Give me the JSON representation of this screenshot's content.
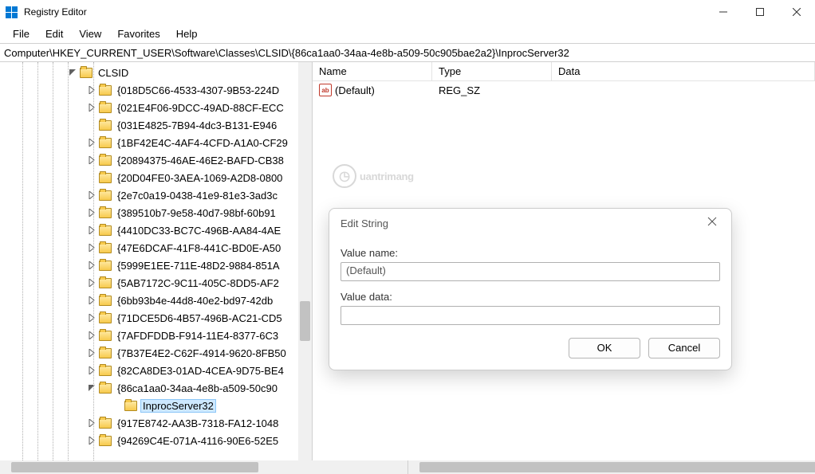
{
  "titlebar": {
    "title": "Registry Editor"
  },
  "menu": {
    "file": "File",
    "edit": "Edit",
    "view": "View",
    "favorites": "Favorites",
    "help": "Help"
  },
  "address": "Computer\\HKEY_CURRENT_USER\\Software\\Classes\\CLSID\\{86ca1aa0-34aa-4e8b-a509-50c905bae2a2}\\InprocServer32",
  "tree": {
    "root": "CLSID",
    "items": [
      "{018D5C66-4533-4307-9B53-224D",
      "{021E4F06-9DCC-49AD-88CF-ECC",
      "{031E4825-7B94-4dc3-B131-E946",
      "{1BF42E4C-4AF4-4CFD-A1A0-CF29",
      "{20894375-46AE-46E2-BAFD-CB38",
      "{20D04FE0-3AEA-1069-A2D8-0800",
      "{2e7c0a19-0438-41e9-81e3-3ad3c",
      "{389510b7-9e58-40d7-98bf-60b91",
      "{4410DC33-BC7C-496B-AA84-4AE",
      "{47E6DCAF-41F8-441C-BD0E-A50",
      "{5999E1EE-711E-48D2-9884-851A",
      "{5AB7172C-9C11-405C-8DD5-AF2",
      "{6bb93b4e-44d8-40e2-bd97-42db",
      "{71DCE5D6-4B57-496B-AC21-CD5",
      "{7AFDFDDB-F914-11E4-8377-6C3",
      "{7B37E4E2-C62F-4914-9620-8FB50",
      "{82CA8DE3-01AD-4CEA-9D75-BE4",
      "{86ca1aa0-34aa-4e8b-a509-50c90",
      "{917E8742-AA3B-7318-FA12-1048",
      "{94269C4E-071A-4116-90E6-52E5"
    ],
    "selected_child": "InprocServer32"
  },
  "value_header": {
    "name": "Name",
    "type": "Type",
    "data": "Data"
  },
  "value_row": {
    "name": "(Default)",
    "type": "REG_SZ",
    "data": ""
  },
  "watermark": "uantrimang",
  "dialog": {
    "title": "Edit String",
    "value_name_label": "Value name:",
    "value_name": "(Default)",
    "value_data_label": "Value data:",
    "value_data": "",
    "ok": "OK",
    "cancel": "Cancel"
  }
}
